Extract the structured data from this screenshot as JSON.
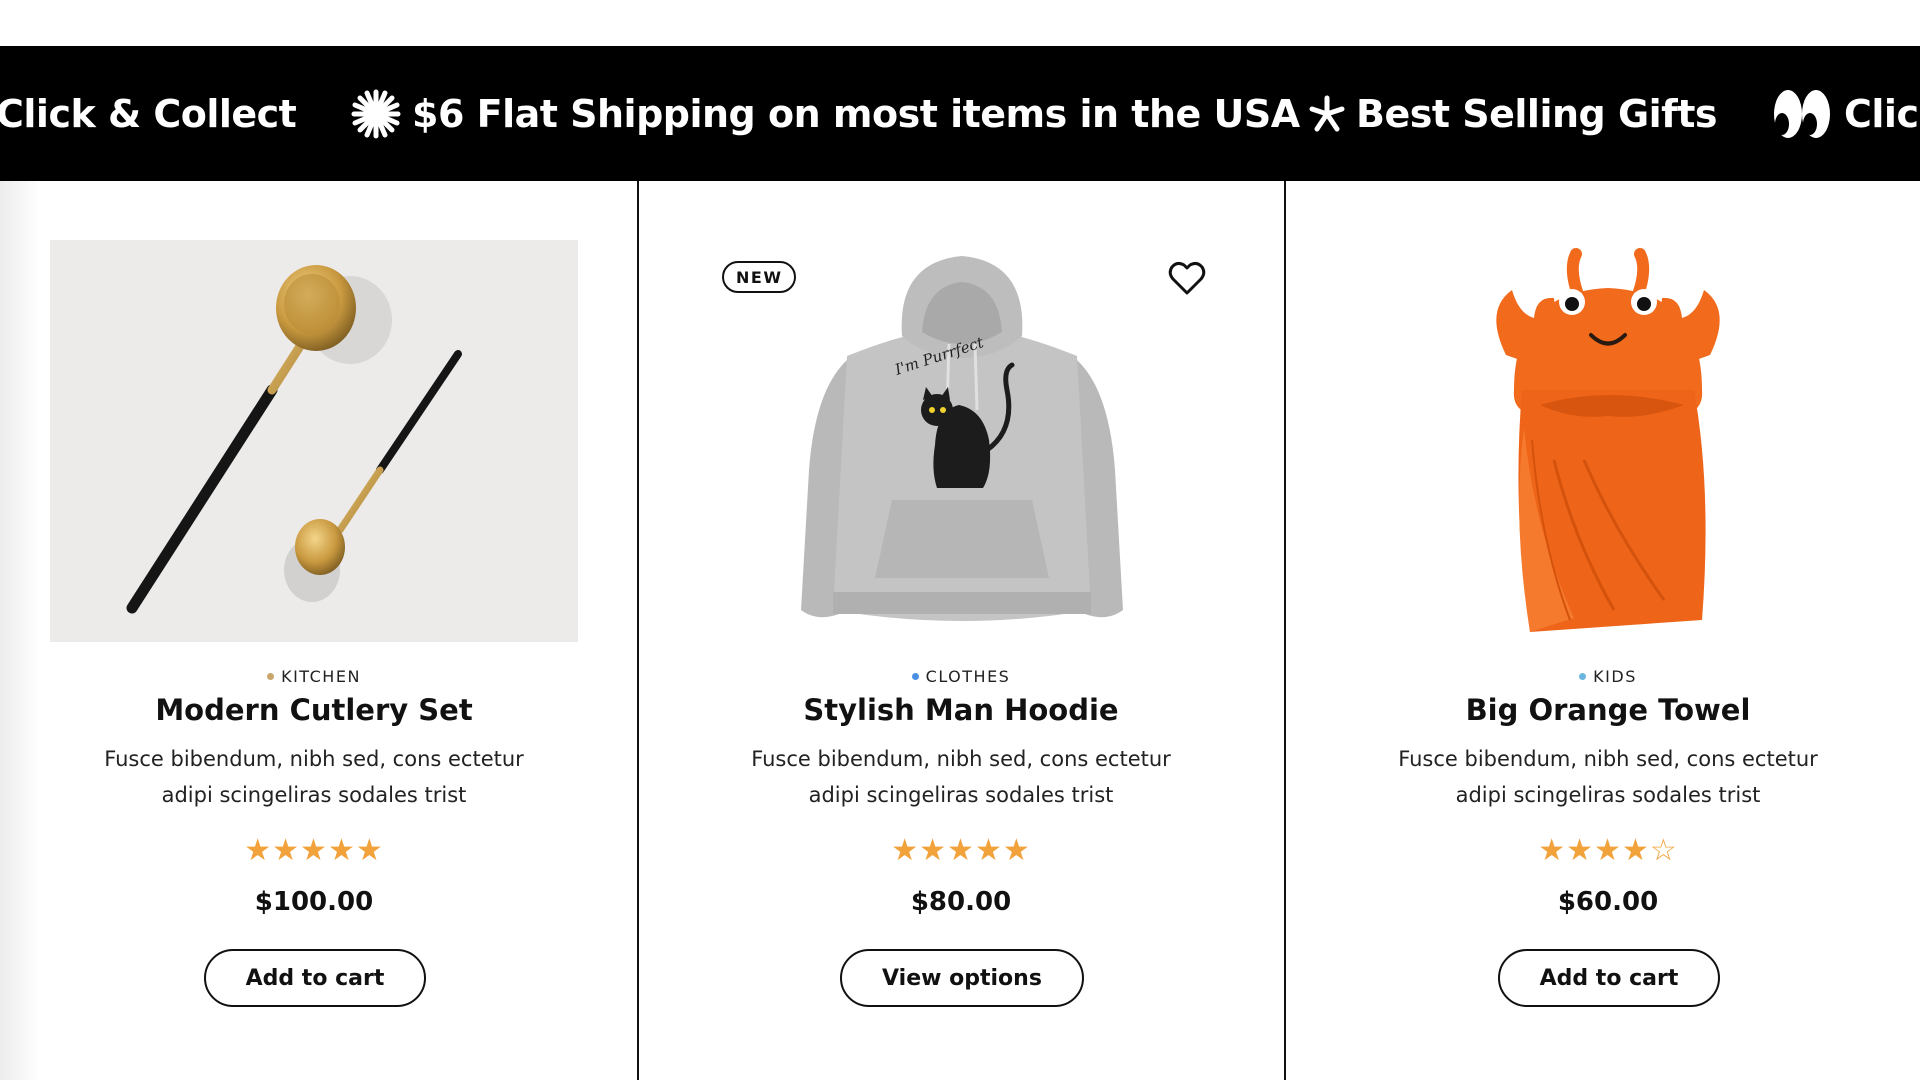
{
  "ticker": {
    "items": [
      {
        "icon": "none",
        "text": "Click & Collect"
      },
      {
        "icon": "asterisk-burst-icon",
        "text": "$6 Flat Shipping on most items in the USA"
      },
      {
        "icon": "star-asterisk-icon",
        "text": "Best Selling Gifts"
      },
      {
        "icon": "eyes-icon",
        "text": "Clic"
      }
    ]
  },
  "products": [
    {
      "category": "KITCHEN",
      "category_color": "#c9a56a",
      "title": "Modern Cutlery Set",
      "description": "Fusce bibendum, nibh sed, cons ectetur adipi scingeliras sodales trist",
      "rating": 5,
      "rating_max": 5,
      "price": "$100.00",
      "button": "Add to cart",
      "badge": "",
      "image": "cutlery-image"
    },
    {
      "category": "CLOTHES",
      "category_color": "#4a90e2",
      "title": "Stylish Man Hoodie",
      "description": "Fusce bibendum, nibh sed, cons ectetur adipi scingeliras sodales trist",
      "rating": 5,
      "rating_max": 5,
      "price": "$80.00",
      "button": "View options",
      "badge": "NEW",
      "hoodie_text": "I'm Purrfect",
      "image": "hoodie-image"
    },
    {
      "category": "KIDS",
      "category_color": "#6bb6e0",
      "title": "Big Orange Towel",
      "description": "Fusce bibendum, nibh sed, cons ectetur adipi scingeliras sodales trist",
      "rating": 4,
      "rating_max": 5,
      "price": "$60.00",
      "button": "Add to cart",
      "badge": "",
      "image": "towel-image"
    }
  ],
  "colors": {
    "star": "#f2a23a",
    "ticker_bg": "#000000",
    "accent_orange": "#f26a1b"
  }
}
